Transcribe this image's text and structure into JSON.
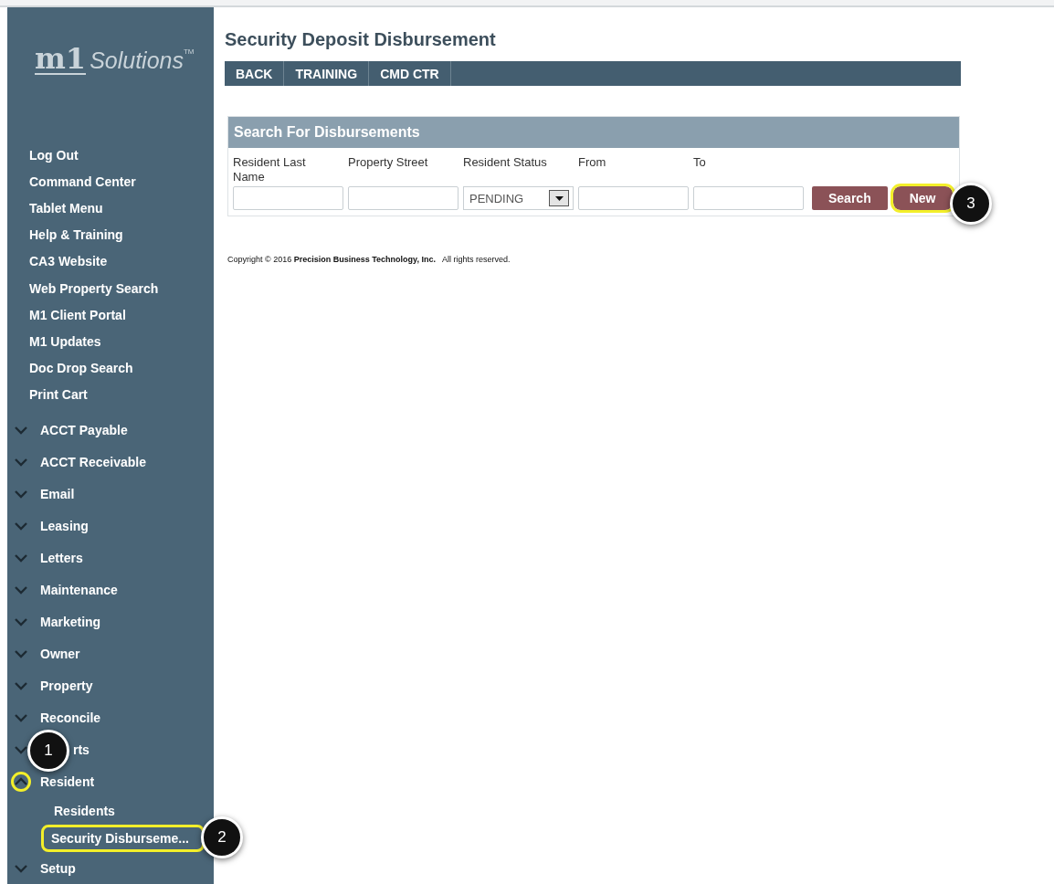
{
  "logo": {
    "mark": "m1",
    "text": "Solutions",
    "trademark": "TM"
  },
  "sidebar": {
    "items": [
      {
        "kind": "link",
        "label": "Log Out"
      },
      {
        "kind": "link",
        "label": "Command Center"
      },
      {
        "kind": "link",
        "label": "Tablet Menu"
      },
      {
        "kind": "link",
        "label": "Help & Training"
      },
      {
        "kind": "link",
        "label": "CA3 Website"
      },
      {
        "kind": "link",
        "label": "Web Property Search"
      },
      {
        "kind": "link",
        "label": "M1 Client Portal"
      },
      {
        "kind": "link",
        "label": "M1 Updates"
      },
      {
        "kind": "link",
        "label": "Doc Drop Search"
      },
      {
        "kind": "link",
        "label": "Print Cart"
      },
      {
        "kind": "group",
        "label": "ACCT Payable",
        "expanded": false,
        "highlighted": false
      },
      {
        "kind": "group",
        "label": "ACCT Receivable",
        "expanded": false,
        "highlighted": false
      },
      {
        "kind": "group",
        "label": "Email",
        "expanded": false,
        "highlighted": false
      },
      {
        "kind": "group",
        "label": "Leasing",
        "expanded": false,
        "highlighted": false
      },
      {
        "kind": "group",
        "label": "Letters",
        "expanded": false,
        "highlighted": false
      },
      {
        "kind": "group",
        "label": "Maintenance",
        "expanded": false,
        "highlighted": false
      },
      {
        "kind": "group",
        "label": "Marketing",
        "expanded": false,
        "highlighted": false
      },
      {
        "kind": "group",
        "label": "Owner",
        "expanded": false,
        "highlighted": false
      },
      {
        "kind": "group",
        "label": "Property",
        "expanded": false,
        "highlighted": false
      },
      {
        "kind": "group",
        "label": "Reconcile",
        "expanded": false,
        "highlighted": false
      },
      {
        "kind": "group",
        "label": "rts",
        "expanded": false,
        "highlighted": false,
        "covered": true
      },
      {
        "kind": "group",
        "label": "Resident",
        "expanded": true,
        "highlighted": true,
        "children": [
          {
            "label": "Residents",
            "highlighted": false
          },
          {
            "label": "Security Disburseme...",
            "highlighted": true
          }
        ]
      },
      {
        "kind": "group",
        "label": "Setup",
        "expanded": false,
        "highlighted": false
      }
    ]
  },
  "page": {
    "title": "Security Deposit Disbursement",
    "toolbar": [
      "BACK",
      "TRAINING",
      "CMD CTR"
    ]
  },
  "search_panel": {
    "title": "Search For Disbursements",
    "fields": [
      {
        "kind": "text",
        "label": "Resident Last Name"
      },
      {
        "kind": "text",
        "label": "Property Street"
      },
      {
        "kind": "select",
        "label": "Resident Status",
        "value": "PENDING"
      },
      {
        "kind": "text",
        "label": "From"
      },
      {
        "kind": "text",
        "label": "To"
      }
    ],
    "buttons": [
      {
        "label": "Search",
        "highlighted": false
      },
      {
        "label": "New",
        "highlighted": true
      }
    ]
  },
  "footer": {
    "copyright": "Copyright © 2016 **Precision Business Technology, Inc.**   All rights reserved."
  },
  "annotations": [
    "1",
    "2",
    "3"
  ]
}
